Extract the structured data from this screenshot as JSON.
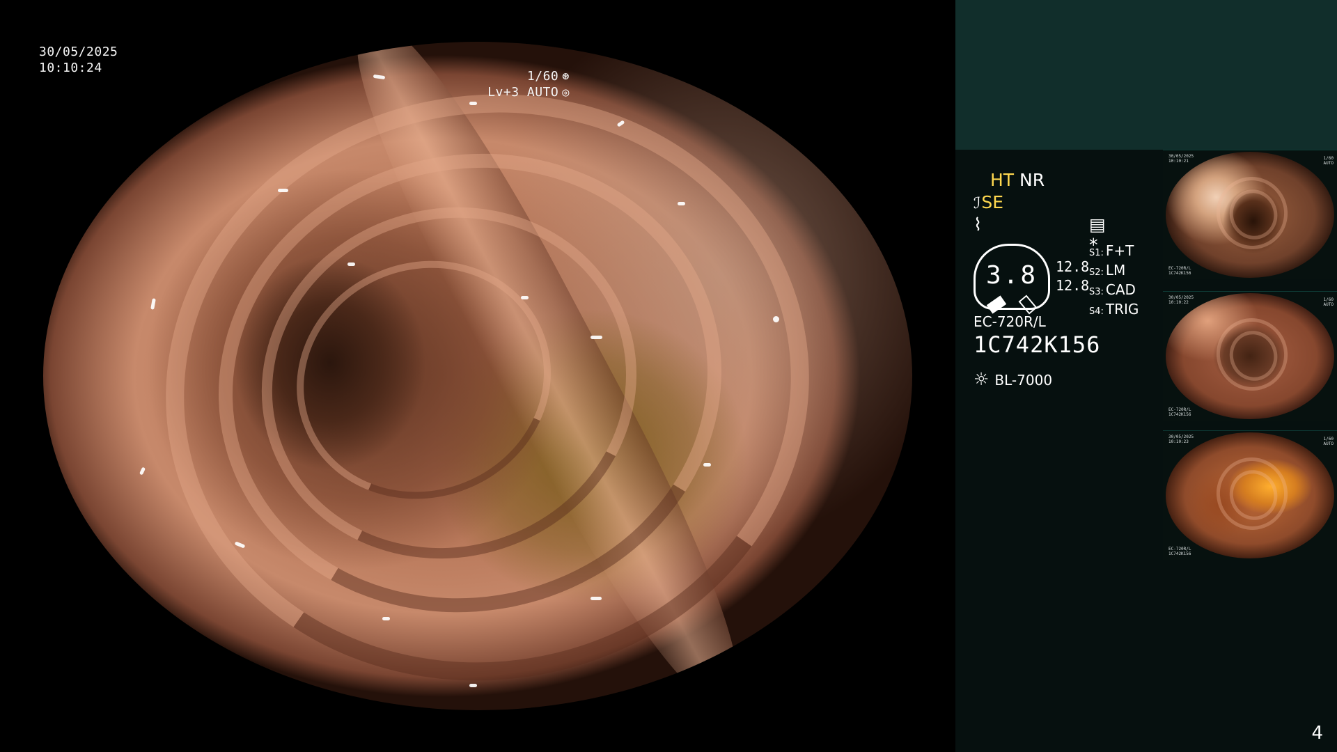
{
  "endoscope_view": {
    "date": "30/05/2025",
    "time": "10:10:24",
    "shutter": "1/60",
    "shutter_icon": "aperture-icon",
    "exposure": "Lv+3 AUTO",
    "exposure_icon": "iris-icon"
  },
  "status_panel": {
    "ht_label": "HT",
    "nr_label": "NR",
    "se_symbol": "ℐ",
    "se_label": "SE",
    "wave_symbol": "⌇",
    "settings_icon": "▤",
    "star": "*",
    "gauge_value": "3.8",
    "values": [
      "12.8",
      "12.8"
    ],
    "modes": [
      {
        "prefix": "S1:",
        "label": "F+T"
      },
      {
        "prefix": "S2:",
        "label": "LM"
      },
      {
        "prefix": "S3:",
        "label": "CAD"
      },
      {
        "prefix": "S4:",
        "label": "TRIG"
      }
    ],
    "scope_model": "EC-720R/L",
    "serial_number": "1C742K156",
    "light_source_icon": "lamp-icon",
    "light_source": "BL-7000"
  },
  "thumbnails": [
    {
      "top_left": "30/05/2025\n10:10:21",
      "bottom_left": "EC-720R/L\n1C742K156",
      "top_right": "1/60\nAUTO"
    },
    {
      "top_left": "30/05/2025\n10:10:22",
      "bottom_left": "EC-720R/L\n1C742K156",
      "top_right": "1/60\nAUTO"
    },
    {
      "top_left": "30/05/2025\n10:10:23",
      "bottom_left": "EC-720R/L\n1C742K156",
      "top_right": "1/60\nAUTO"
    }
  ],
  "page_number": "4",
  "colors": {
    "panel_teal": "#112e2b",
    "panel_dark": "#06100f",
    "status_yellow": "#ffd84f"
  }
}
